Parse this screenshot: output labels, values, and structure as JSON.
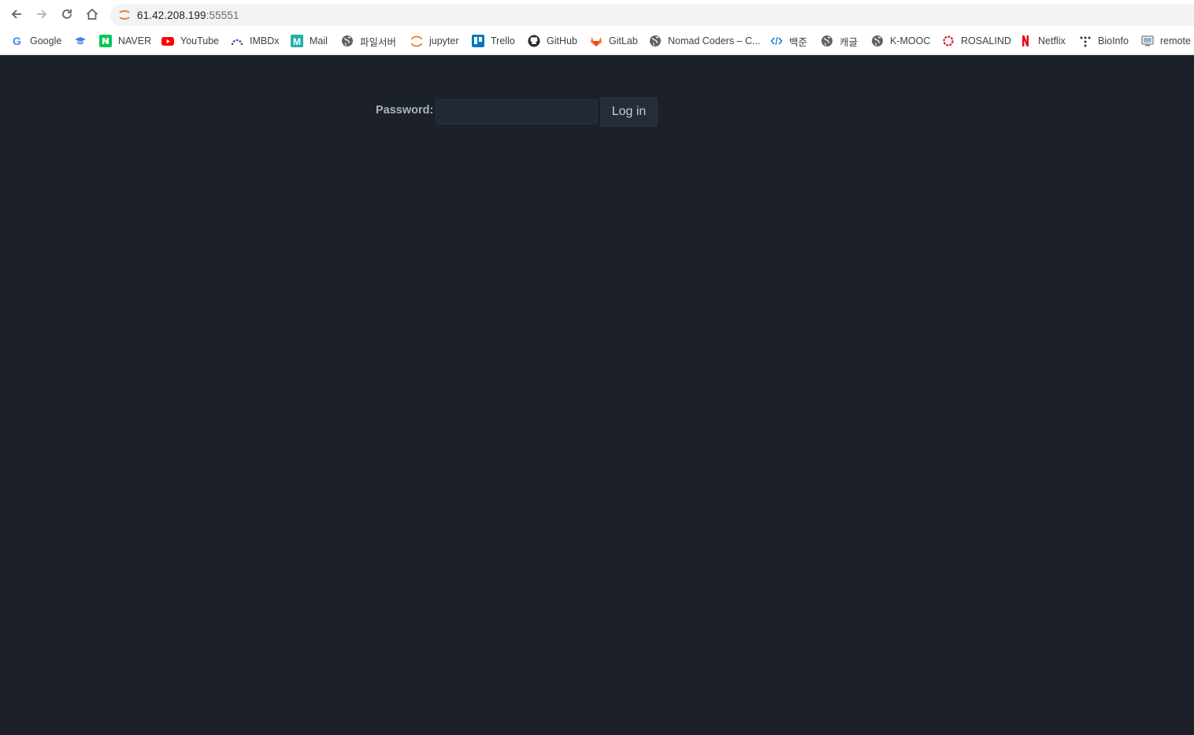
{
  "browser": {
    "url_host": "61.42.208.199",
    "url_port": ":55551",
    "bookmarks": [
      {
        "label": "Google",
        "icon": "google-icon"
      },
      {
        "label": "",
        "icon": "cap-icon"
      },
      {
        "label": "NAVER",
        "icon": "naver-icon"
      },
      {
        "label": "YouTube",
        "icon": "youtube-icon"
      },
      {
        "label": "IMBDx",
        "icon": "imbdx-icon"
      },
      {
        "label": "Mail",
        "icon": "mail-icon"
      },
      {
        "label": "파일서버",
        "icon": "globe-icon"
      },
      {
        "label": "jupyter",
        "icon": "jupyter-icon"
      },
      {
        "label": "Trello",
        "icon": "trello-icon"
      },
      {
        "label": "GitHub",
        "icon": "github-icon"
      },
      {
        "label": "GitLab",
        "icon": "gitlab-icon"
      },
      {
        "label": "Nomad Coders – C...",
        "icon": "globe-icon"
      },
      {
        "label": "백준",
        "icon": "code-icon"
      },
      {
        "label": "캐글",
        "icon": "globe-icon"
      },
      {
        "label": "K-MOOC",
        "icon": "globe-icon"
      },
      {
        "label": "ROSALIND",
        "icon": "rosalind-icon"
      },
      {
        "label": "Netflix",
        "icon": "netflix-icon"
      },
      {
        "label": "BioInfo",
        "icon": "dots-icon"
      },
      {
        "label": "remote",
        "icon": "remote-icon"
      }
    ]
  },
  "login": {
    "password_label": "Password:",
    "password_value": "",
    "login_button": "Log in"
  }
}
